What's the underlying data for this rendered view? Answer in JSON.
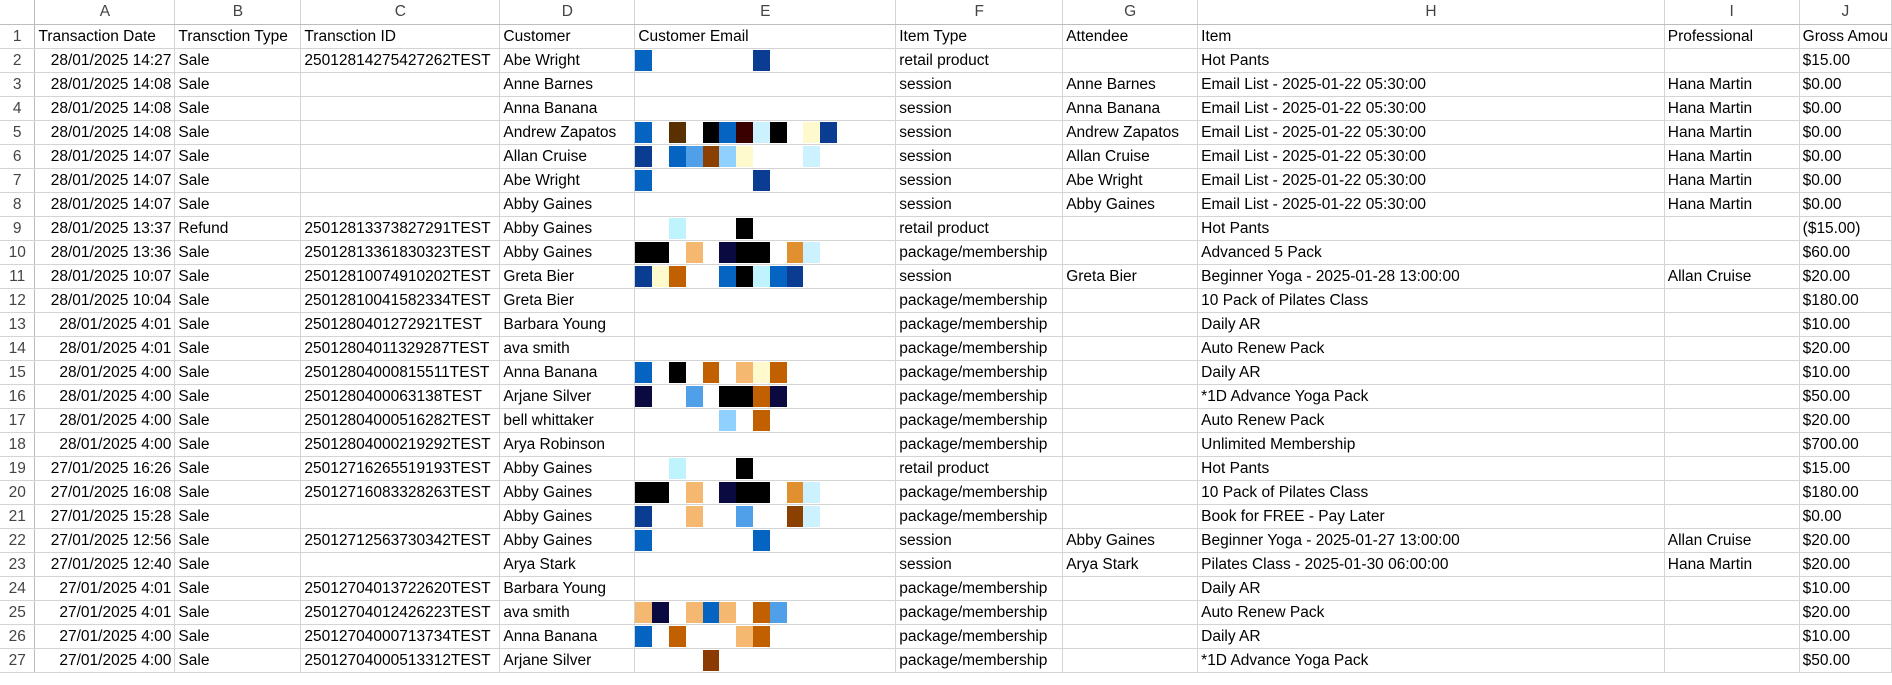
{
  "columns": [
    "",
    "A",
    "B",
    "C",
    "D",
    "E",
    "F",
    "G",
    "H",
    "I",
    "J"
  ],
  "header_row": [
    "Transaction Date",
    "Transction Type",
    "Transction ID",
    "Customer",
    "Customer Email",
    "Item Type",
    "Attendee",
    "Item",
    "Professional",
    "Gross Amou"
  ],
  "rows": [
    {
      "n": "2",
      "date": "28/01/2025 14:27",
      "type": "Sale",
      "id": "25012814275427262TEST",
      "customer": "Abe Wright",
      "item_type": "retail product",
      "attendee": "",
      "item": "Hot Pants",
      "professional": "",
      "gross": "$15.00"
    },
    {
      "n": "3",
      "date": "28/01/2025 14:08",
      "type": "Sale",
      "id": "",
      "customer": "Anne Barnes",
      "item_type": "session",
      "attendee": "Anne Barnes",
      "item": "Email List - 2025-01-22 05:30:00",
      "professional": "Hana Martin",
      "gross": "$0.00"
    },
    {
      "n": "4",
      "date": "28/01/2025 14:08",
      "type": "Sale",
      "id": "",
      "customer": "Anna Banana",
      "item_type": "session",
      "attendee": "Anna Banana",
      "item": "Email List - 2025-01-22 05:30:00",
      "professional": "Hana Martin",
      "gross": "$0.00"
    },
    {
      "n": "5",
      "date": "28/01/2025 14:08",
      "type": "Sale",
      "id": "",
      "customer": "Andrew Zapatos",
      "item_type": "session",
      "attendee": "Andrew Zapatos",
      "item": "Email List - 2025-01-22 05:30:00",
      "professional": "Hana Martin",
      "gross": "$0.00"
    },
    {
      "n": "6",
      "date": "28/01/2025 14:07",
      "type": "Sale",
      "id": "",
      "customer": "Allan Cruise",
      "item_type": "session",
      "attendee": "Allan Cruise",
      "item": "Email List - 2025-01-22 05:30:00",
      "professional": "Hana Martin",
      "gross": "$0.00"
    },
    {
      "n": "7",
      "date": "28/01/2025 14:07",
      "type": "Sale",
      "id": "",
      "customer": "Abe Wright",
      "item_type": "session",
      "attendee": "Abe Wright",
      "item": "Email List - 2025-01-22 05:30:00",
      "professional": "Hana Martin",
      "gross": "$0.00"
    },
    {
      "n": "8",
      "date": "28/01/2025 14:07",
      "type": "Sale",
      "id": "",
      "customer": "Abby Gaines",
      "item_type": "session",
      "attendee": "Abby Gaines",
      "item": "Email List - 2025-01-22 05:30:00",
      "professional": "Hana Martin",
      "gross": "$0.00"
    },
    {
      "n": "9",
      "date": "28/01/2025 13:37",
      "type": "Refund",
      "id": "25012813373827291TEST",
      "customer": "Abby Gaines",
      "item_type": "retail product",
      "attendee": "",
      "item": "Hot Pants",
      "professional": "",
      "gross": "($15.00)"
    },
    {
      "n": "10",
      "date": "28/01/2025 13:36",
      "type": "Sale",
      "id": "25012813361830323TEST",
      "customer": "Abby Gaines",
      "item_type": "package/membership",
      "attendee": "",
      "item": "Advanced 5 Pack",
      "professional": "",
      "gross": "$60.00"
    },
    {
      "n": "11",
      "date": "28/01/2025 10:07",
      "type": "Sale",
      "id": "25012810074910202TEST",
      "customer": "Greta Bier",
      "item_type": "session",
      "attendee": "Greta Bier",
      "item": "Beginner Yoga - 2025-01-28 13:00:00",
      "professional": "Allan Cruise",
      "gross": "$20.00"
    },
    {
      "n": "12",
      "date": "28/01/2025 10:04",
      "type": "Sale",
      "id": "25012810041582334TEST",
      "customer": "Greta Bier",
      "item_type": "package/membership",
      "attendee": "",
      "item": "10 Pack of Pilates Class",
      "professional": "",
      "gross": "$180.00"
    },
    {
      "n": "13",
      "date": "28/01/2025 4:01",
      "type": "Sale",
      "id": "2501280401272921TEST",
      "customer": "Barbara Young",
      "item_type": "package/membership",
      "attendee": "",
      "item": "Daily AR",
      "professional": "",
      "gross": "$10.00"
    },
    {
      "n": "14",
      "date": "28/01/2025 4:01",
      "type": "Sale",
      "id": "25012804011329287TEST",
      "customer": "ava smith",
      "item_type": "package/membership",
      "attendee": "",
      "item": "Auto Renew Pack",
      "professional": "",
      "gross": "$20.00"
    },
    {
      "n": "15",
      "date": "28/01/2025 4:00",
      "type": "Sale",
      "id": "25012804000815511TEST",
      "customer": "Anna Banana",
      "item_type": "package/membership",
      "attendee": "",
      "item": "Daily AR",
      "professional": "",
      "gross": "$10.00"
    },
    {
      "n": "16",
      "date": "28/01/2025 4:00",
      "type": "Sale",
      "id": "2501280400063138TEST",
      "customer": "Arjane Silver",
      "item_type": "package/membership",
      "attendee": "",
      "item": "*1D Advance Yoga Pack",
      "professional": "",
      "gross": "$50.00"
    },
    {
      "n": "17",
      "date": "28/01/2025 4:00",
      "type": "Sale",
      "id": "25012804000516282TEST",
      "customer": "bell whittaker",
      "item_type": "package/membership",
      "attendee": "",
      "item": "Auto Renew Pack",
      "professional": "",
      "gross": "$20.00"
    },
    {
      "n": "18",
      "date": "28/01/2025 4:00",
      "type": "Sale",
      "id": "25012804000219292TEST",
      "customer": "Arya Robinson",
      "item_type": "package/membership",
      "attendee": "",
      "item": "Unlimited Membership",
      "professional": "",
      "gross": "$700.00"
    },
    {
      "n": "19",
      "date": "27/01/2025 16:26",
      "type": "Sale",
      "id": "25012716265519193TEST",
      "customer": "Abby Gaines",
      "item_type": "retail product",
      "attendee": "",
      "item": "Hot Pants",
      "professional": "",
      "gross": "$15.00"
    },
    {
      "n": "20",
      "date": "27/01/2025 16:08",
      "type": "Sale",
      "id": "25012716083328263TEST",
      "customer": "Abby Gaines",
      "item_type": "package/membership",
      "attendee": "",
      "item": "10 Pack of Pilates Class",
      "professional": "",
      "gross": "$180.00"
    },
    {
      "n": "21",
      "date": "27/01/2025 15:28",
      "type": "Sale",
      "id": "",
      "customer": "Abby Gaines",
      "item_type": "package/membership",
      "attendee": "",
      "item": "Book for FREE - Pay Later",
      "professional": "",
      "gross": "$0.00"
    },
    {
      "n": "22",
      "date": "27/01/2025 12:56",
      "type": "Sale",
      "id": "25012712563730342TEST",
      "customer": "Abby Gaines",
      "item_type": "session",
      "attendee": "Abby Gaines",
      "item": "Beginner Yoga - 2025-01-27 13:00:00",
      "professional": "Allan Cruise",
      "gross": "$20.00"
    },
    {
      "n": "23",
      "date": "27/01/2025 12:40",
      "type": "Sale",
      "id": "",
      "customer": "Arya Stark",
      "item_type": "session",
      "attendee": "Arya Stark",
      "item": "Pilates Class - 2025-01-30 06:00:00",
      "professional": "Hana Martin",
      "gross": "$20.00"
    },
    {
      "n": "24",
      "date": "27/01/2025 4:01",
      "type": "Sale",
      "id": "25012704013722620TEST",
      "customer": "Barbara Young",
      "item_type": "package/membership",
      "attendee": "",
      "item": "Daily AR",
      "professional": "",
      "gross": "$10.00"
    },
    {
      "n": "25",
      "date": "27/01/2025 4:01",
      "type": "Sale",
      "id": "25012704012426223TEST",
      "customer": "ava smith",
      "item_type": "package/membership",
      "attendee": "",
      "item": "Auto Renew Pack",
      "professional": "",
      "gross": "$20.00"
    },
    {
      "n": "26",
      "date": "27/01/2025 4:00",
      "type": "Sale",
      "id": "25012704000713734TEST",
      "customer": "Anna Banana",
      "item_type": "package/membership",
      "attendee": "",
      "item": "Daily AR",
      "professional": "",
      "gross": "$10.00"
    },
    {
      "n": "27",
      "date": "27/01/2025 4:00",
      "type": "Sale",
      "id": "25012704000513312TEST",
      "customer": "Arjane Silver",
      "item_type": "package/membership",
      "attendee": "",
      "item": "*1D Advance Yoga Pack",
      "professional": "",
      "gross": "$50.00"
    }
  ],
  "redaction_pixels": [
    [
      "#0563c1",
      "",
      "",
      "",
      "",
      "",
      "",
      "#0a3d91",
      "",
      "",
      "",
      ""
    ],
    [],
    [],
    [
      "#0563c1",
      "",
      "#5a3000",
      "",
      "#000000",
      "#0563c1",
      "#3a0000",
      "#ccf2ff",
      "#000000",
      "",
      "#fffacd",
      "#0a3d91"
    ],
    [
      "#0a3d91",
      "",
      "#0563c1",
      "#4fa0e8",
      "#8b4000",
      "#8fd0ff",
      "#fffacd",
      "",
      "",
      "",
      "#ccf2ff",
      ""
    ],
    [
      "#0563c1",
      "",
      "",
      "",
      "",
      "",
      "",
      "#0a3d91",
      "",
      "",
      "",
      ""
    ],
    [],
    [
      "",
      "",
      "#bff4ff",
      "",
      "",
      "",
      "#000000",
      "",
      "",
      "",
      "",
      ""
    ],
    [
      "#000000",
      "#000000",
      "",
      "#f5b870",
      "",
      "#0a0a40",
      "#000000",
      "#000000",
      "",
      "#e0902e",
      "#ccf2ff",
      ""
    ],
    [
      "#0a3d91",
      "#fffacd",
      "#c06000",
      "",
      "",
      "#0563c1",
      "#000000",
      "#bff4ff",
      "#0563c1",
      "#0a3d91",
      "",
      ""
    ],
    [],
    [],
    [],
    [
      "#0563c1",
      "",
      "#000000",
      "",
      "#c06000",
      "",
      "#f5b870",
      "#fffacd",
      "#c06000",
      "",
      "",
      ""
    ],
    [
      "#0a0a40",
      "",
      "",
      "#4fa0e8",
      "",
      "#000000",
      "#000000",
      "#c06000",
      "#0a0a40",
      "",
      "",
      ""
    ],
    [
      "",
      "",
      "",
      "",
      "",
      "#8fd0ff",
      "",
      "#c06000",
      "",
      "",
      "",
      ""
    ],
    [],
    [
      "",
      "",
      "#bff4ff",
      "",
      "",
      "",
      "#000000",
      "",
      "",
      "",
      "",
      ""
    ],
    [
      "#000000",
      "#000000",
      "",
      "#f5b870",
      "",
      "#0a0a40",
      "#000000",
      "#000000",
      "",
      "#e0902e",
      "#ccf2ff",
      ""
    ],
    [
      "#0a3d91",
      "",
      "",
      "#f5b870",
      "",
      "",
      "#4fa0e8",
      "",
      "",
      "#8b4000",
      "#ccf2ff",
      ""
    ],
    [
      "#0563c1",
      "",
      "",
      "",
      "",
      "",
      "",
      "#0563c1",
      "",
      "",
      "",
      ""
    ],
    [],
    [],
    [
      "#f5b870",
      "#0a0a40",
      "",
      "#f5b870",
      "#0563c1",
      "#f5b870",
      "",
      "#c06000",
      "#4fa0e8",
      "",
      "",
      ""
    ],
    [
      "#0563c1",
      "",
      "#c06000",
      "",
      "",
      "",
      "#f5b870",
      "#c06000",
      "",
      "",
      "",
      ""
    ],
    [
      "",
      "",
      "",
      "",
      "#8b3a00",
      "",
      "",
      "",
      "",
      "",
      "",
      ""
    ]
  ]
}
